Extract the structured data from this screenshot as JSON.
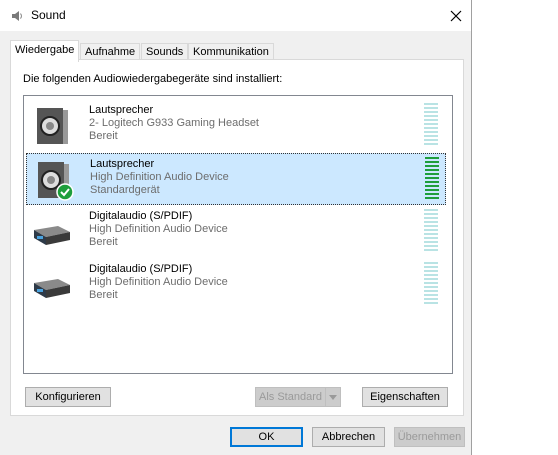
{
  "window": {
    "title": "Sound",
    "icon": "speaker-icon",
    "close_icon": "close-icon"
  },
  "tabs": [
    {
      "label": "Wiedergabe",
      "active": true
    },
    {
      "label": "Aufnahme",
      "active": false
    },
    {
      "label": "Sounds",
      "active": false
    },
    {
      "label": "Kommunikation",
      "active": false
    }
  ],
  "panel": {
    "label": "Die folgenden Audiowiedergabegeräte sind installiert:"
  },
  "devices": [
    {
      "name": "Lautsprecher",
      "description": "2- Logitech G933 Gaming Headset",
      "status": "Bereit",
      "icon": "speaker-icon",
      "selected": false,
      "default": false,
      "level": 0
    },
    {
      "name": "Lautsprecher",
      "description": "High Definition Audio Device",
      "status": "Standardgerät",
      "icon": "speaker-icon",
      "selected": true,
      "default": true,
      "level": 1.0
    },
    {
      "name": "Digitalaudio (S/PDIF)",
      "description": "High Definition Audio Device",
      "status": "Bereit",
      "icon": "digital-audio-icon",
      "selected": false,
      "default": false,
      "level": 0
    },
    {
      "name": "Digitalaudio (S/PDIF)",
      "description": "High Definition Audio Device",
      "status": "Bereit",
      "icon": "digital-audio-icon",
      "selected": false,
      "default": false,
      "level": 0
    }
  ],
  "buttons": {
    "configure": "Konfigurieren",
    "set_default": "Als Standard",
    "properties": "Eigenschaften",
    "ok": "OK",
    "cancel": "Abbrechen",
    "apply": "Übernehmen"
  },
  "colors": {
    "selection": "#cce8ff",
    "meter_active": "#1e9e3c",
    "meter_idle": "#b9e3e4",
    "default_check": "#1e9e3c"
  }
}
